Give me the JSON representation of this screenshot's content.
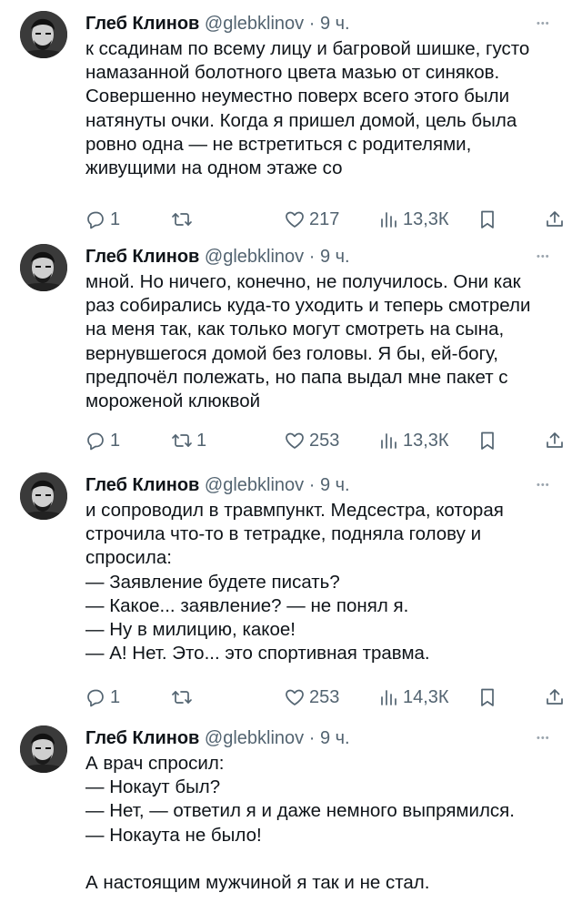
{
  "tweets": [
    {
      "author": "Глеб Клинов",
      "handle": "@glebklinov",
      "time": "9 ч.",
      "lines": [
        "к ссадинам по всему лицу и багровой шишке, густо",
        "намазанной болотного цвета мазью от синяков.",
        "Совершенно неуместно поверх всего этого были",
        "натянуты очки. Когда я пришел домой, цель была",
        "ровно одна — не встретиться с родителями,",
        "живущими на одном этаже со"
      ],
      "replies": "1",
      "retweets": "",
      "likes": "217",
      "views": "13,3К"
    },
    {
      "author": "Глеб Клинов",
      "handle": "@glebklinov",
      "time": "9 ч.",
      "lines": [
        "мной. Но ничего, конечно, не получилось. Они как",
        "раз собирались куда-то уходить и теперь смотрели",
        "на меня так, как только могут смотреть на сына,",
        "вернувшегося домой без головы. Я бы, ей-богу,",
        "предпочёл полежать, но папа выдал мне пакет с",
        "мороженой клюквой"
      ],
      "replies": "1",
      "retweets": "1",
      "likes": "253",
      "views": "13,3К"
    },
    {
      "author": "Глеб Клинов",
      "handle": "@glebklinov",
      "time": "9 ч.",
      "lines": [
        "и сопроводил в травмпункт. Медсестра, которая",
        "строчила что-то в тетрадке, подняла голову и",
        "спросила:",
        "— Заявление будете писать?",
        "— Какое... заявление? — не понял я.",
        "— Ну в милицию, какое!",
        "— А! Нет. Это... это спортивная травма."
      ],
      "replies": "1",
      "retweets": "",
      "likes": "253",
      "views": "14,3К"
    },
    {
      "author": "Глеб Клинов",
      "handle": "@glebklinov",
      "time": "9 ч.",
      "lines": [
        "А врач спросил:",
        "— Нокаут был?",
        "— Нет, — ответил я и даже немного выпрямился.",
        "— Нокаута не было!",
        "",
        "А настоящим мужчиной я так и не стал."
      ]
    }
  ],
  "icons": {
    "more": "more-icon",
    "reply": "reply-icon",
    "retweet": "retweet-icon",
    "like": "heart-icon",
    "views": "views-icon",
    "bookmark": "bookmark-icon",
    "share": "share-icon"
  },
  "colors": {
    "text": "#0f1419",
    "secondary": "#536471"
  }
}
